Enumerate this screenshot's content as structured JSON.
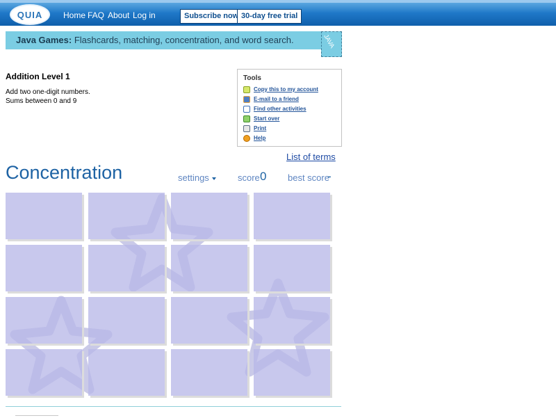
{
  "nav": {
    "logo": "QUIA",
    "links": [
      "Home",
      "FAQ",
      "About",
      "Log in"
    ],
    "subscribe": "Subscribe now",
    "trial": "30-day free trial"
  },
  "banner": {
    "bold": "Java Games:",
    "rest": " Flashcards, matching, concentration, and word search.",
    "badge": "JAVA"
  },
  "activity": {
    "title": "Addition Level 1",
    "desc1": "Add two one-digit numbers.",
    "desc2": "Sums between 0 and 9"
  },
  "tools": {
    "title": "Tools",
    "items": [
      {
        "label": "Copy this to my account",
        "icon": "copy-icon"
      },
      {
        "label": "E-mail to a friend",
        "icon": "email-icon"
      },
      {
        "label": "Find other activities",
        "icon": "search-icon"
      },
      {
        "label": "Start over",
        "icon": "restart-icon"
      },
      {
        "label": "Print",
        "icon": "print-icon"
      },
      {
        "label": "Help",
        "icon": "help-icon"
      }
    ]
  },
  "game": {
    "list_of_terms": "List of terms",
    "title": "Concentration",
    "settings": "settings",
    "score_label": "score",
    "score_value": "0",
    "best_label": "best score",
    "best_value": "-"
  },
  "colors": {
    "nav_blue": "#1f78c8",
    "banner_teal": "#7bcde3",
    "card_lavender": "#b8b8e8",
    "title_blue": "#1e63a4"
  }
}
